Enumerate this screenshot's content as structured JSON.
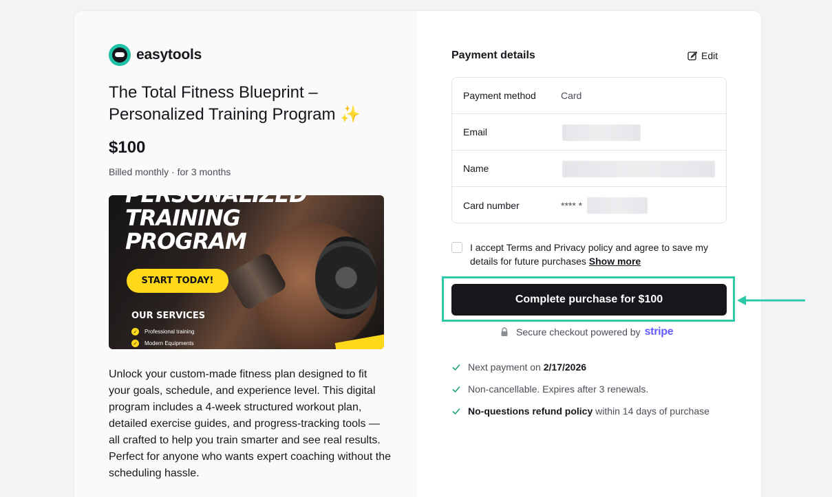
{
  "brand": {
    "name": "easytools"
  },
  "product": {
    "title": "The Total Fitness Blueprint – Personalized Training Program",
    "title_emoji": "✨",
    "price": "$100",
    "billing": "Billed monthly · for 3 months",
    "description": "Unlock your custom-made fitness plan designed to fit your goals, schedule, and experience level. This digital program includes a 4-week structured workout plan, detailed exercise guides, and progress-tracking tools — all crafted to help you train smarter and see real results. Perfect for anyone who wants expert coaching without the scheduling hassle."
  },
  "promo": {
    "heading_1": "PERSONALIZED",
    "heading_2": "TRAINING",
    "heading_3": "PROGRAM",
    "cta": "START TODAY!",
    "services_title": "OUR SERVICES",
    "service_1": "Professional training",
    "service_2": "Modern Equipments"
  },
  "payment": {
    "title": "Payment details",
    "edit_label": "Edit",
    "rows": [
      {
        "label": "Payment method",
        "value": "Card"
      },
      {
        "label": "Email",
        "value": ""
      },
      {
        "label": "Name",
        "value": ""
      },
      {
        "label": "Card number",
        "value": "**** *"
      }
    ],
    "consent_text": "I accept Terms and Privacy policy and agree to save my details for future purchases",
    "show_more": "Show more",
    "purchase_button": "Complete purchase for $100",
    "secure_text": "Secure checkout powered by",
    "stripe": "stripe"
  },
  "bullets": {
    "next_payment_label": "Next payment on",
    "next_payment_date": "2/17/2026",
    "renewals": "Non-cancellable. Expires after 3 renewals.",
    "refund_bold": "No-questions refund policy",
    "refund_rest": "within 14 days of purchase"
  },
  "colors": {
    "accent": "#2ec9a7",
    "button": "#16171d",
    "stripe": "#635bff"
  }
}
